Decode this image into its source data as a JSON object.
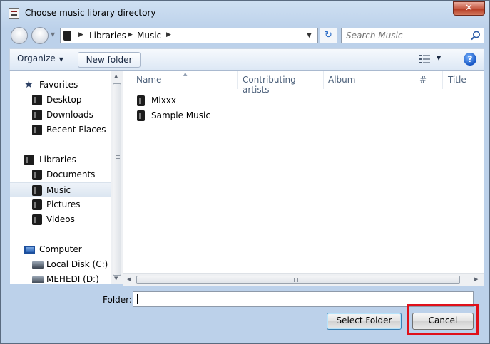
{
  "window": {
    "title": "Choose music library directory",
    "close_glyph": "✕"
  },
  "address": {
    "crumbs": [
      "Libraries",
      "Music"
    ],
    "separator": "▶",
    "dropdown_glyph": "▼",
    "refresh_glyph": "↻"
  },
  "search": {
    "placeholder": "Search Music"
  },
  "toolbar": {
    "organize_label": "Organize",
    "new_folder_label": "New folder",
    "help_glyph": "?",
    "caret_glyph": "▼"
  },
  "nav": {
    "favorites_header": "Favorites",
    "favorites": [
      "Desktop",
      "Downloads",
      "Recent Places"
    ],
    "libraries_header": "Libraries",
    "libraries": [
      "Documents",
      "Music",
      "Pictures",
      "Videos"
    ],
    "computer_header": "Computer",
    "drives": [
      "Local Disk (C:)",
      "MEHEDI (D:)"
    ],
    "selected": "Music"
  },
  "columns": [
    "Name",
    "Contributing artists",
    "Album",
    "#",
    "Title"
  ],
  "files": [
    "Mixxx",
    "Sample Music"
  ],
  "bottom": {
    "folder_label": "Folder:",
    "folder_value": "",
    "select_button": "Select Folder",
    "cancel_button": "Cancel"
  },
  "colors": {
    "highlight": "#e0101a",
    "close": "#c75a44",
    "accent": "#1656c4"
  }
}
